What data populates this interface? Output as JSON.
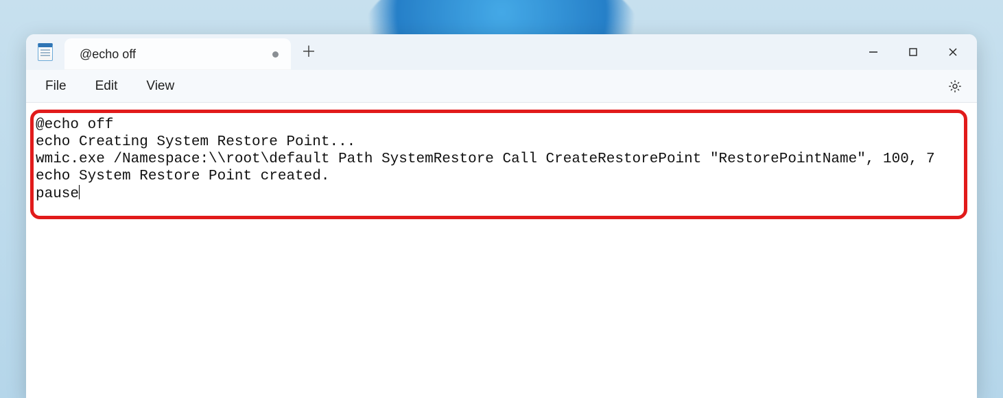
{
  "tab": {
    "title": "@echo off",
    "dirty": true
  },
  "menu": {
    "file": "File",
    "edit": "Edit",
    "view": "View"
  },
  "editor": {
    "lines": [
      "@echo off",
      "echo Creating System Restore Point...",
      "wmic.exe /Namespace:\\\\root\\default Path SystemRestore Call CreateRestorePoint \"RestorePointName\", 100, 7",
      "echo System Restore Point created.",
      "pause"
    ]
  }
}
